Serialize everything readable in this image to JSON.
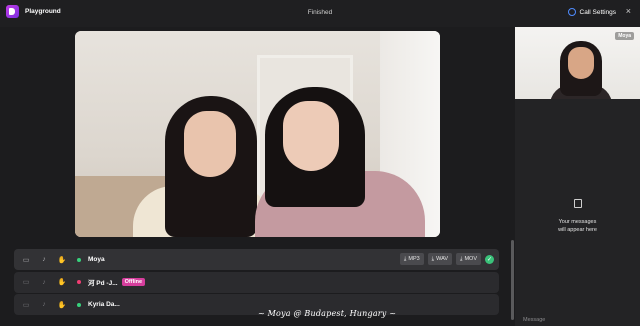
{
  "app": {
    "name": "Playground",
    "status": "Finished"
  },
  "header": {
    "settings_label": "Call Settings",
    "close_glyph": "×"
  },
  "participants": [
    {
      "name": "Moya",
      "online": true,
      "offline_label": "",
      "exports": [
        "MP3",
        "WAV",
        "MOV"
      ],
      "complete": true
    },
    {
      "name": "河 Pd -J...",
      "online": false,
      "offline_label": "Offline",
      "exports": [],
      "complete": false
    },
    {
      "name": "Kyria Da...",
      "online": true,
      "offline_label": "",
      "exports": [],
      "complete": false
    }
  ],
  "sidebar": {
    "self_tag": "Moya",
    "empty_line1": "Your messages",
    "empty_line2": "will appear here",
    "message_placeholder": "Message"
  },
  "caption": "~ Moya @ Budapest, Hungary ~",
  "icons": {
    "camera": "camera-icon",
    "mic": "microphone-icon",
    "hand": "hand-icon",
    "download": "download-icon",
    "check": "check-icon"
  },
  "colors": {
    "online": "#37d27c",
    "offline": "#f03d72",
    "offline_badge": "#d63e9d",
    "accent": "#4f8cff"
  }
}
